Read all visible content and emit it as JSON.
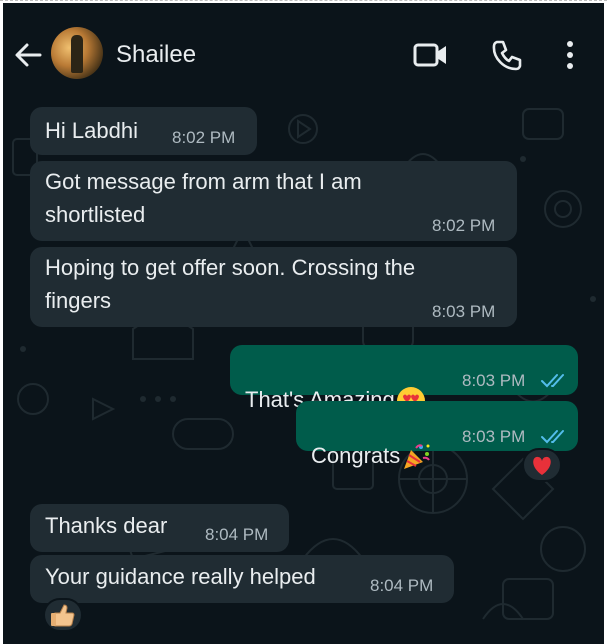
{
  "header": {
    "contact_name": "Shailee",
    "icons": [
      "back-arrow-icon",
      "video-call-icon",
      "voice-call-icon",
      "more-options-icon"
    ]
  },
  "colors": {
    "background": "#0b141a",
    "incoming_bubble": "#202c33",
    "outgoing_bubble": "#005c4b",
    "read_ticks": "#53bdeb"
  },
  "messages": [
    {
      "direction": "in",
      "text": "Hi Labdhi",
      "time": "8:02 PM"
    },
    {
      "direction": "in",
      "text": "Got message from arm that I am\nshortlisted",
      "time": "8:02 PM"
    },
    {
      "direction": "in",
      "text": "Hoping to get offer soon. Crossing the\nfingers",
      "time": "8:03 PM"
    },
    {
      "direction": "out",
      "text": "That's Amazing",
      "emoji": "heart-eyes-emoji",
      "time": "8:03 PM",
      "status": "read"
    },
    {
      "direction": "out",
      "text": "Congrats",
      "emoji": "party-popper-emoji",
      "time": "8:03 PM",
      "status": "read",
      "reaction": "red-heart-emoji"
    },
    {
      "direction": "in",
      "text": "Thanks dear",
      "time": "8:04 PM"
    },
    {
      "direction": "in",
      "text": "Your guidance really helped",
      "time": "8:04 PM",
      "reaction": "thumbs-up-emoji"
    }
  ]
}
